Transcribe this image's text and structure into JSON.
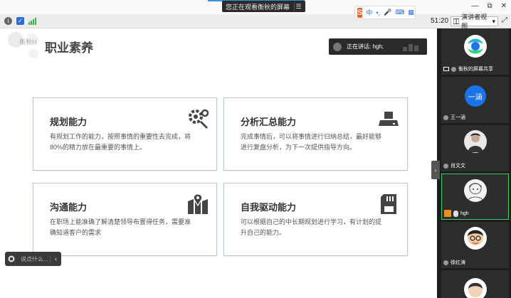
{
  "topbar": {
    "share_notice": "您正在观看衡秋的屏幕",
    "menu_glyph": "☰",
    "window_controls": [
      "—",
      "⧉",
      "✕"
    ]
  },
  "ime": {
    "logo": "S",
    "lang": "中",
    "items": [
      "•,",
      "🎤",
      "⌨",
      "▦"
    ]
  },
  "toolbar2": {
    "time": "51:20",
    "view_label": "演讲者视图",
    "view_arrow": "▾"
  },
  "slide": {
    "logo_text": "衡秋H",
    "title": "职业素养",
    "speaker_text": "正在讲话: hgh;",
    "cards": [
      {
        "title": "规划能力",
        "desc": "有规划工作的能力，按照事情的重要性去完成，将80%的精力放在最重要的事情上。",
        "icon": "gear-wrench-icon"
      },
      {
        "title": "分析汇总能力",
        "desc": "完成事情后，可以将事情进行归纳总结，最好能够进行复盘分析，为下一次提供指导方向。",
        "icon": "printer-icon"
      },
      {
        "title": "沟通能力",
        "desc": "在职场上能准确了解清楚领导布置得任务，需要准确知道客户的需求",
        "icon": "map-pin-icon"
      },
      {
        "title": "自我驱动能力",
        "desc": "可以根据自己的中长期规划进行学习，有计划的提升自己的能力。",
        "icon": "sd-card-icon"
      }
    ]
  },
  "chat": {
    "placeholder": "说点什么...",
    "arrow": "‹"
  },
  "collapse_arrow": "›",
  "participants": [
    {
      "name": "衡秋的屏幕共享",
      "kind": "screen"
    },
    {
      "name": "王一涵",
      "kind": "avatar-text",
      "avatar_text": "一涵",
      "color": "#1a73e8"
    },
    {
      "name": "肖文文",
      "kind": "photo"
    },
    {
      "name": "hgh",
      "kind": "sketch",
      "active": true
    },
    {
      "name": "徐红涛",
      "kind": "cartoon"
    },
    {
      "name": "",
      "kind": "partial"
    }
  ],
  "colors": {
    "accent_green": "#3bd069",
    "card_border": "#bcc7d2",
    "brand_orange": "#f05a22"
  }
}
